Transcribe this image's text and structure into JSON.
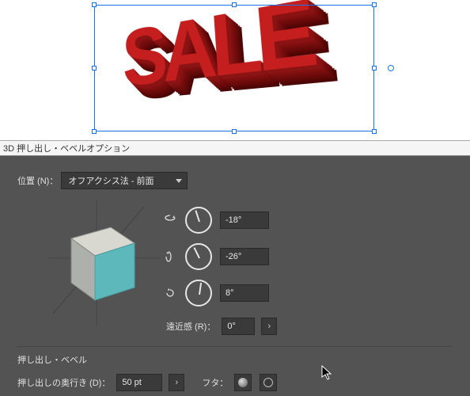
{
  "canvas": {
    "text": "SALE"
  },
  "panel": {
    "title": "3D 押し出し・ベベルオプション",
    "position": {
      "label": "位置 (N)：",
      "value": "オフアクシス法 - 前面"
    },
    "rotation": {
      "x": {
        "value": "-18°"
      },
      "y": {
        "value": "-26°"
      },
      "z": {
        "value": "8°"
      }
    },
    "perspective": {
      "label": "遠近感 (R)：",
      "value": "0°"
    },
    "section2": {
      "title": "押し出し・ベベル",
      "depth_label": "押し出しの奥行き (D)：",
      "depth_value": "50 pt",
      "cap_label": "フタ："
    }
  },
  "icons": {
    "rot_x": "↻",
    "rot_y": "↺",
    "rot_z": "⟳",
    "step_right": "›"
  }
}
